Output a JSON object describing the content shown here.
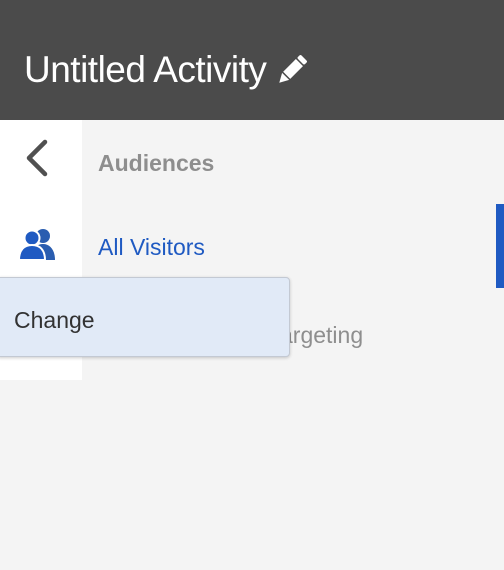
{
  "header": {
    "title": "Untitled Activity",
    "edit_icon": "pencil-icon"
  },
  "sidebar": {
    "back_icon": "chevron-left-icon",
    "audience_icon": "people-icon"
  },
  "panel": {
    "section_title": "Audiences",
    "selected_audience": "All Visitors",
    "partial_text": "argeting"
  },
  "popover": {
    "change_label": "Change"
  },
  "colors": {
    "header_bg": "#4b4b4b",
    "accent": "#1f5ac2",
    "popover_bg": "#e1eaf7",
    "muted_text": "#8e8e8e"
  }
}
